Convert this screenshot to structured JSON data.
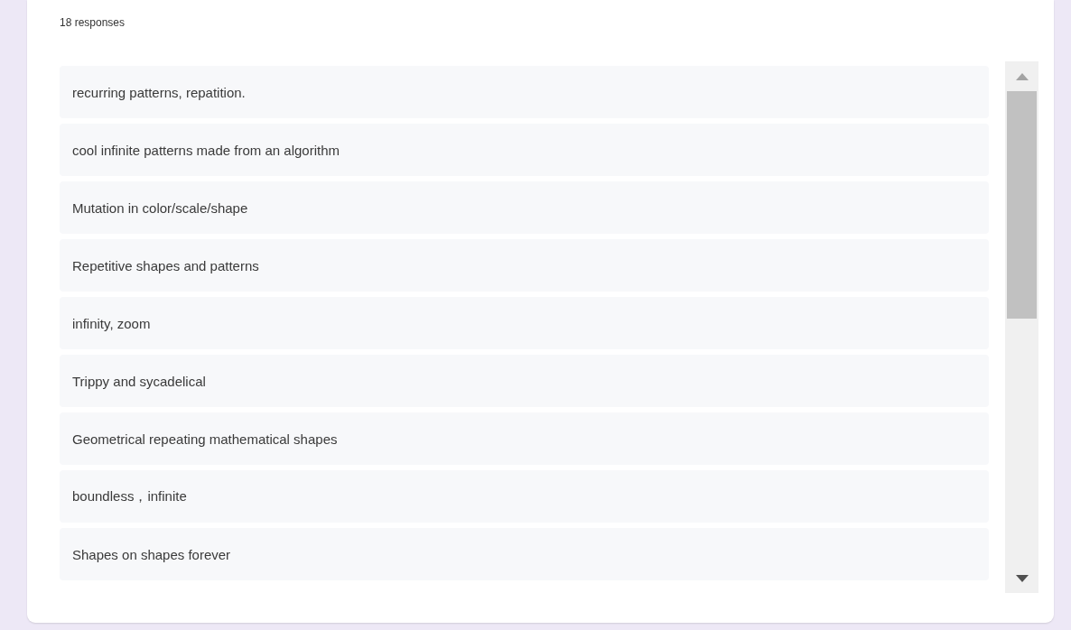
{
  "response_count": "18 responses",
  "responses": [
    "recurring patterns, repatition.",
    "cool infinite patterns made from an algorithm",
    "Mutation in color/scale/shape",
    "Repetitive shapes and patterns",
    "infinity, zoom",
    "Trippy and sycadelical",
    "Geometrical repeating mathematical shapes",
    "boundless，infinite",
    "Shapes on shapes forever"
  ]
}
